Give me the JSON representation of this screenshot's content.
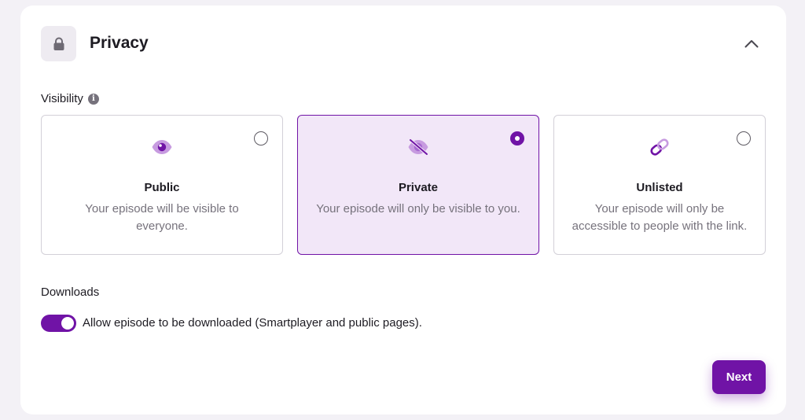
{
  "section": {
    "title": "Privacy",
    "icon": "lock-icon",
    "collapse_icon": "chevron-up-icon"
  },
  "visibility": {
    "label": "Visibility",
    "info_icon": "info-icon",
    "options": [
      {
        "title": "Public",
        "description": "Your episode will be visible to everyone.",
        "icon": "eye-icon",
        "selected": false
      },
      {
        "title": "Private",
        "description": "Your episode will only be visible to you.",
        "icon": "eye-off-icon",
        "selected": true
      },
      {
        "title": "Unlisted",
        "description": "Your episode will only be accessible to people with the link.",
        "icon": "link-icon",
        "selected": false
      }
    ]
  },
  "downloads": {
    "label": "Downloads",
    "toggle_label": "Allow episode to be downloaded (Smartplayer and public pages).",
    "enabled": true
  },
  "actions": {
    "next_label": "Next"
  },
  "colors": {
    "accent": "#7013a6",
    "selected_bg": "#f2e7f8",
    "icon_light": "#c79be0",
    "muted_text": "#76727c"
  }
}
